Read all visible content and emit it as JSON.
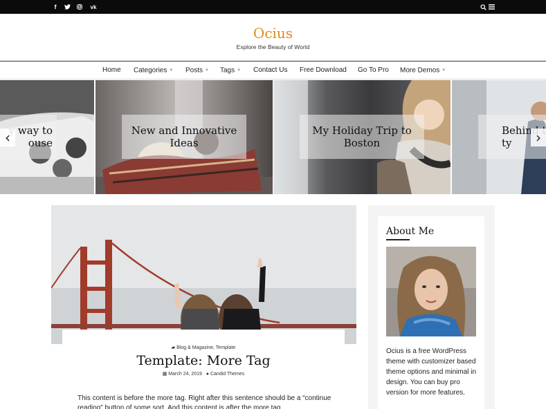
{
  "topbar": {
    "social": [
      {
        "name": "facebook-icon",
        "glyph": "f"
      },
      {
        "name": "twitter-icon",
        "glyph": "t"
      },
      {
        "name": "instagram-icon",
        "glyph": "◎"
      },
      {
        "name": "vk-icon",
        "glyph": "vk"
      }
    ]
  },
  "header": {
    "title": "Ocius",
    "tagline": "Explore the Beauty of World"
  },
  "nav": {
    "items": [
      {
        "label": "Home"
      },
      {
        "label": "Categories",
        "has_dropdown": true
      },
      {
        "label": "Posts",
        "has_dropdown": true
      },
      {
        "label": "Tags",
        "has_dropdown": true
      },
      {
        "label": "Contact Us"
      },
      {
        "label": "Free Download"
      },
      {
        "label": "Go To Pro"
      },
      {
        "label": "More Demos",
        "has_dropdown": true
      }
    ]
  },
  "slider": {
    "slides": [
      {
        "caption_visible": "y way to\nouse"
      },
      {
        "caption": "New and Innovative Ideas"
      },
      {
        "caption": "My Holiday Trip to Boston"
      },
      {
        "caption_visible": "Behind th\nty"
      }
    ],
    "prev_glyph": "‹",
    "next_glyph": "›"
  },
  "post": {
    "categories": "Blog & Magazine, Template",
    "title": "Template: More Tag",
    "date": "March 24, 2019",
    "author": "Candid Themes",
    "excerpt": "This content is before the more tag. Right after this sentence should be a “continue reading” button of some sort. And this content is after the more tag."
  },
  "sidebar": {
    "widget_title": "About Me",
    "about_text": "Ocius is a free WordPress theme with customizer based theme options and minimal in design. You can buy pro version for more features."
  },
  "colors": {
    "brand": "#e08a1e",
    "topbar": "#0b0b0b"
  }
}
